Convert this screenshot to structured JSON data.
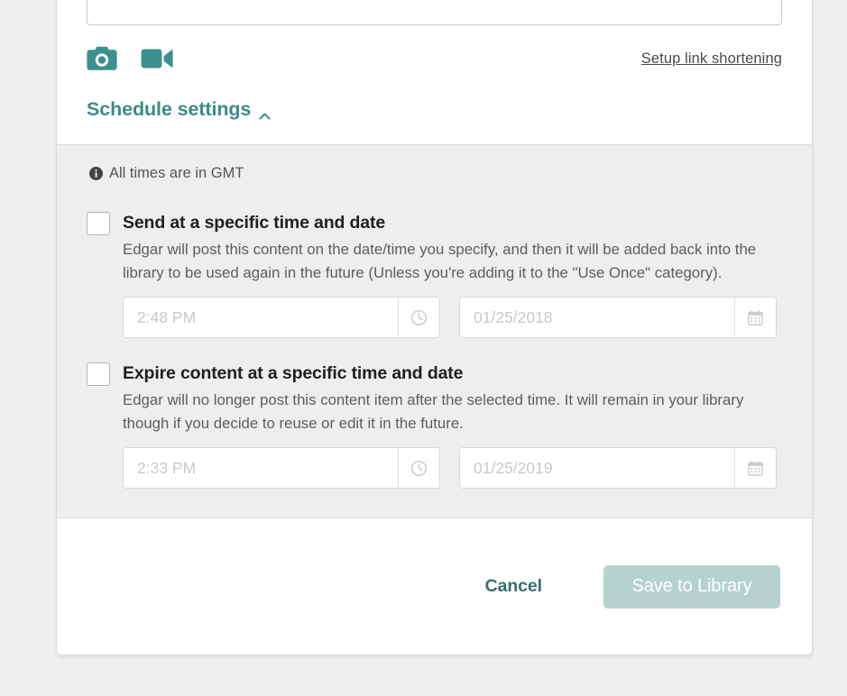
{
  "compose": {
    "textarea_value": "",
    "textarea_placeholder": "",
    "camera_icon": "camera-icon",
    "video_icon": "video-camera-icon",
    "link_shortening_label": "Setup link shortening"
  },
  "schedule": {
    "heading": "Schedule settings",
    "chevron_icon": "chevron-up-icon",
    "timezone_note": "All times are in GMT",
    "info_icon": "info-circle-icon",
    "options": [
      {
        "title": "Send at a specific time and date",
        "description": "Edgar will post this content on the date/time you specify, and then it will be added back into the library to be used again in the future (Unless you're adding it to the \"Use Once\" category).",
        "checked": false,
        "time_value": "",
        "time_placeholder": "2:48 PM",
        "date_value": "",
        "date_placeholder": "01/25/2018",
        "time_icon": "clock-icon",
        "date_icon": "calendar-icon"
      },
      {
        "title": "Expire content at a specific time and date",
        "description": "Edgar will no longer post this content item after the selected time. It will remain in your library though if you decide to reuse or edit it in the future.",
        "checked": false,
        "time_value": "",
        "time_placeholder": "2:33 PM",
        "date_value": "",
        "date_placeholder": "01/25/2019",
        "time_icon": "clock-icon",
        "date_icon": "calendar-icon"
      }
    ]
  },
  "footer": {
    "cancel_label": "Cancel",
    "save_label": "Save to Library"
  },
  "colors": {
    "teal_icon": "#3c9190",
    "teal_heading": "#3c8b87",
    "teal_cancel": "#35706e",
    "save_button_bg": "#b5d2cf",
    "panel_gray": "#eeeeee",
    "page_bg": "#efefef"
  }
}
